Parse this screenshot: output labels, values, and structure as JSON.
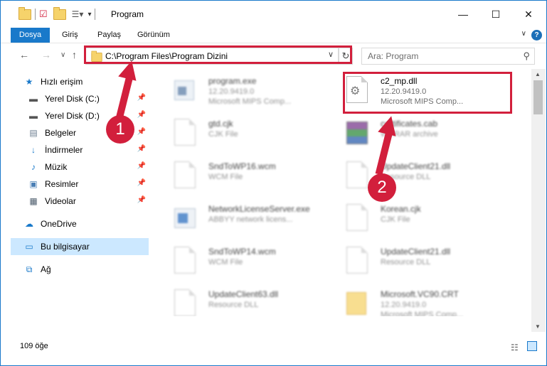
{
  "window": {
    "title": "Program",
    "minimize": "—",
    "maximize": "☐",
    "close": "✕"
  },
  "ribbon": {
    "tabs": [
      "Dosya",
      "Giriş",
      "Paylaş",
      "Görünüm"
    ],
    "help": "?"
  },
  "address": {
    "path": "C:\\Program Files\\Program Dizini",
    "dropdown": "∨",
    "refresh": "↻"
  },
  "search": {
    "placeholder": "Ara: Program"
  },
  "nav": {
    "back": "←",
    "forward": "→",
    "recent": "∨",
    "up": "↑"
  },
  "sidebar": {
    "items": [
      {
        "label": "Hızlı erişim",
        "icon": "star-icon",
        "color": "#1979ca"
      },
      {
        "label": "Yerel Disk (C:)",
        "icon": "drive-icon",
        "pinned": true
      },
      {
        "label": "Yerel Disk (D:)",
        "icon": "drive-icon",
        "pinned": true
      },
      {
        "label": "Belgeler",
        "icon": "documents-icon",
        "pinned": true
      },
      {
        "label": "İndirmeler",
        "icon": "download-icon",
        "pinned": true
      },
      {
        "label": "Müzik",
        "icon": "music-icon",
        "pinned": true
      },
      {
        "label": "Resimler",
        "icon": "pictures-icon",
        "pinned": true
      },
      {
        "label": "Videolar",
        "icon": "videos-icon",
        "pinned": true
      },
      {
        "label": "OneDrive",
        "icon": "cloud-icon"
      },
      {
        "label": "Bu bilgisayar",
        "icon": "computer-icon",
        "selected": true
      },
      {
        "label": "Ağ",
        "icon": "network-icon"
      }
    ]
  },
  "files": {
    "left": [
      {
        "name": "program.exe",
        "line2": "12.20.9419.0",
        "line3": "Microsoft MIPS Comp..."
      },
      {
        "name": "gtd.cjk",
        "line2": "CJK File",
        "line3": ""
      },
      {
        "name": "SndToWP16.wcm",
        "line2": "WCM File",
        "line3": ""
      },
      {
        "name": "NetworkLicenseServer.exe",
        "line2": "ABBYY network licens...",
        "line3": ""
      },
      {
        "name": "SndToWP14.wcm",
        "line2": "WCM File",
        "line3": ""
      },
      {
        "name": "UpdateClient63.dll",
        "line2": "Resource DLL",
        "line3": ""
      }
    ],
    "right": [
      {
        "name": "c2_mp.dll",
        "line2": "12.20.9419.0",
        "line3": "Microsoft MIPS Comp...",
        "highlighted": true
      },
      {
        "name": "certificates.cab",
        "line2": "WinRAR archive",
        "line3": ""
      },
      {
        "name": "UpdateClient21.dll",
        "line2": "Resource DLL",
        "line3": ""
      },
      {
        "name": "Korean.cjk",
        "line2": "CJK File",
        "line3": ""
      },
      {
        "name": "UpdateClient21.dll",
        "line2": "Resource DLL",
        "line3": ""
      },
      {
        "name": "Microsoft.VC90.CRT",
        "line2": "12.20.9419.0",
        "line3": "Microsoft MIPS Comp..."
      }
    ]
  },
  "status": {
    "count": "109 öğe"
  },
  "annotations": {
    "step1": "1",
    "step2": "2",
    "color": "#d21f3c"
  }
}
